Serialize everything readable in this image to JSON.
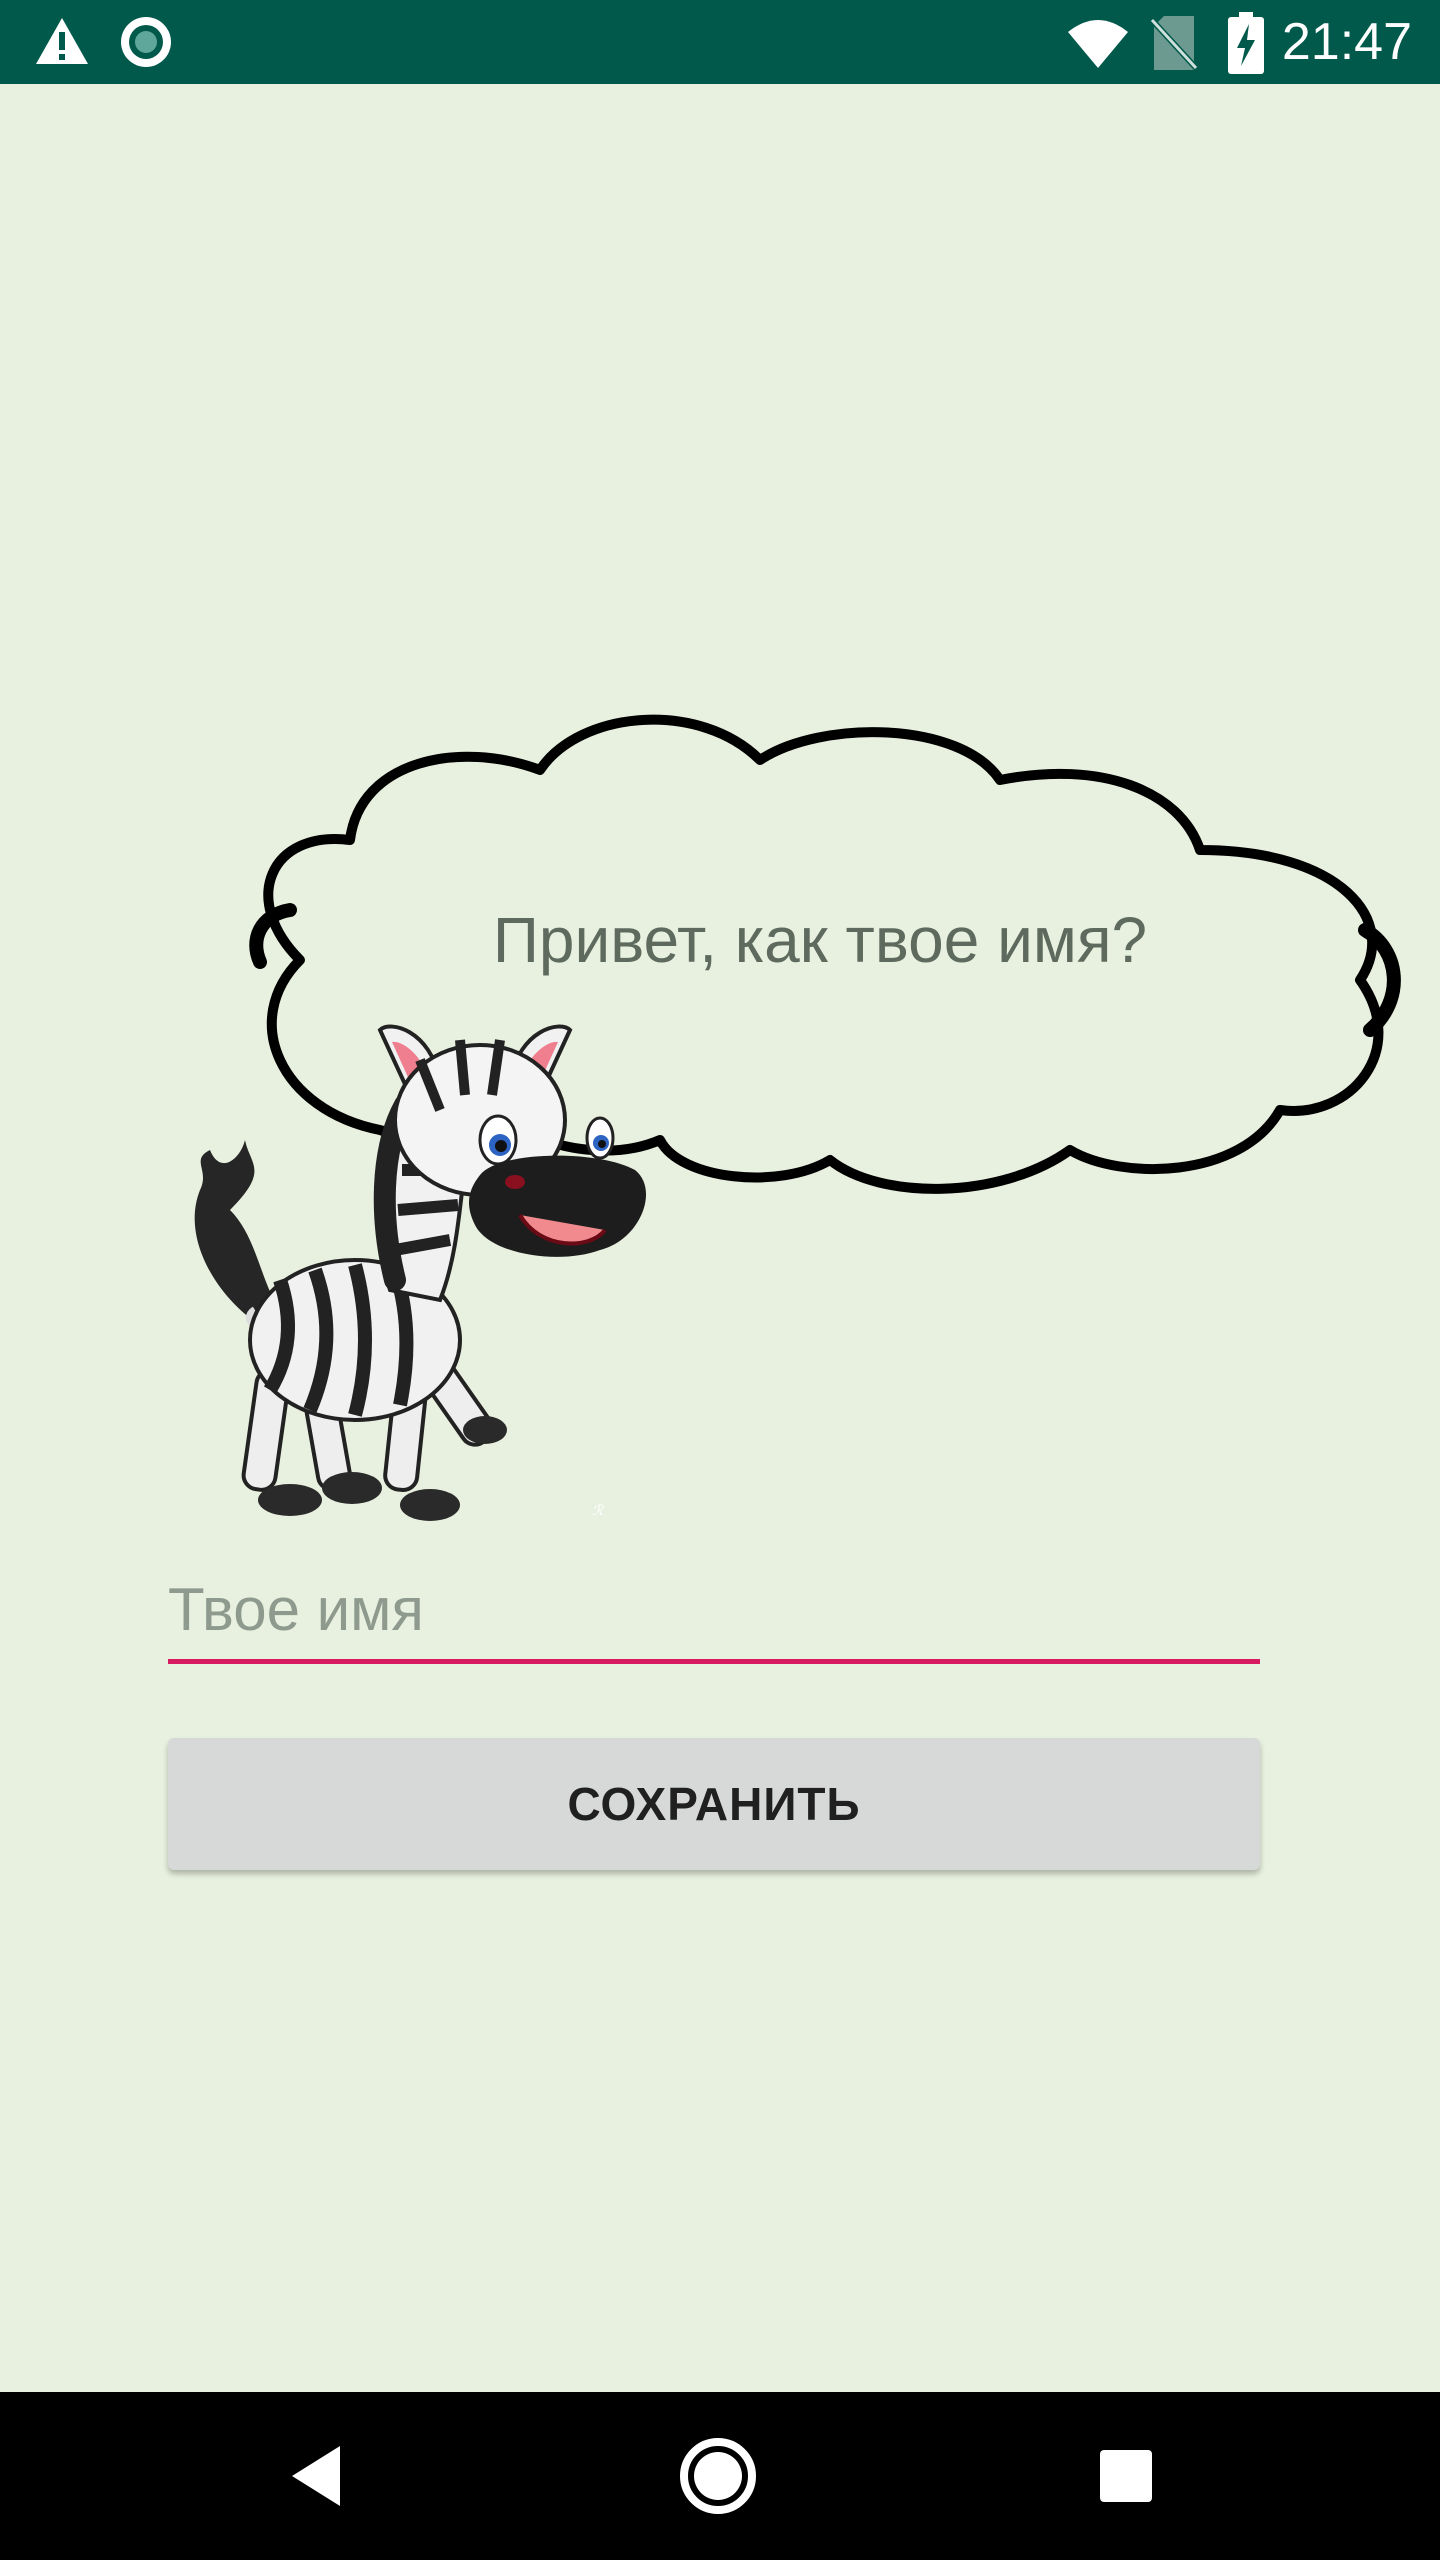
{
  "status_bar": {
    "time": "21:47",
    "icons": [
      "warning-icon",
      "record-icon",
      "wifi-icon",
      "no-sim-icon",
      "battery-charging-icon"
    ]
  },
  "speech_bubble": {
    "text": "Привет, как твое имя?"
  },
  "name_input": {
    "placeholder": "Твое имя",
    "value": ""
  },
  "save_button": {
    "label": "СОХРАНИТЬ"
  },
  "navigation": {
    "icons": [
      "back-icon",
      "home-icon",
      "recents-icon"
    ]
  },
  "colors": {
    "status_bar": "#00594a",
    "background": "#e8f1df",
    "input_underline": "#d81b60",
    "button": "#d7d8d8"
  }
}
